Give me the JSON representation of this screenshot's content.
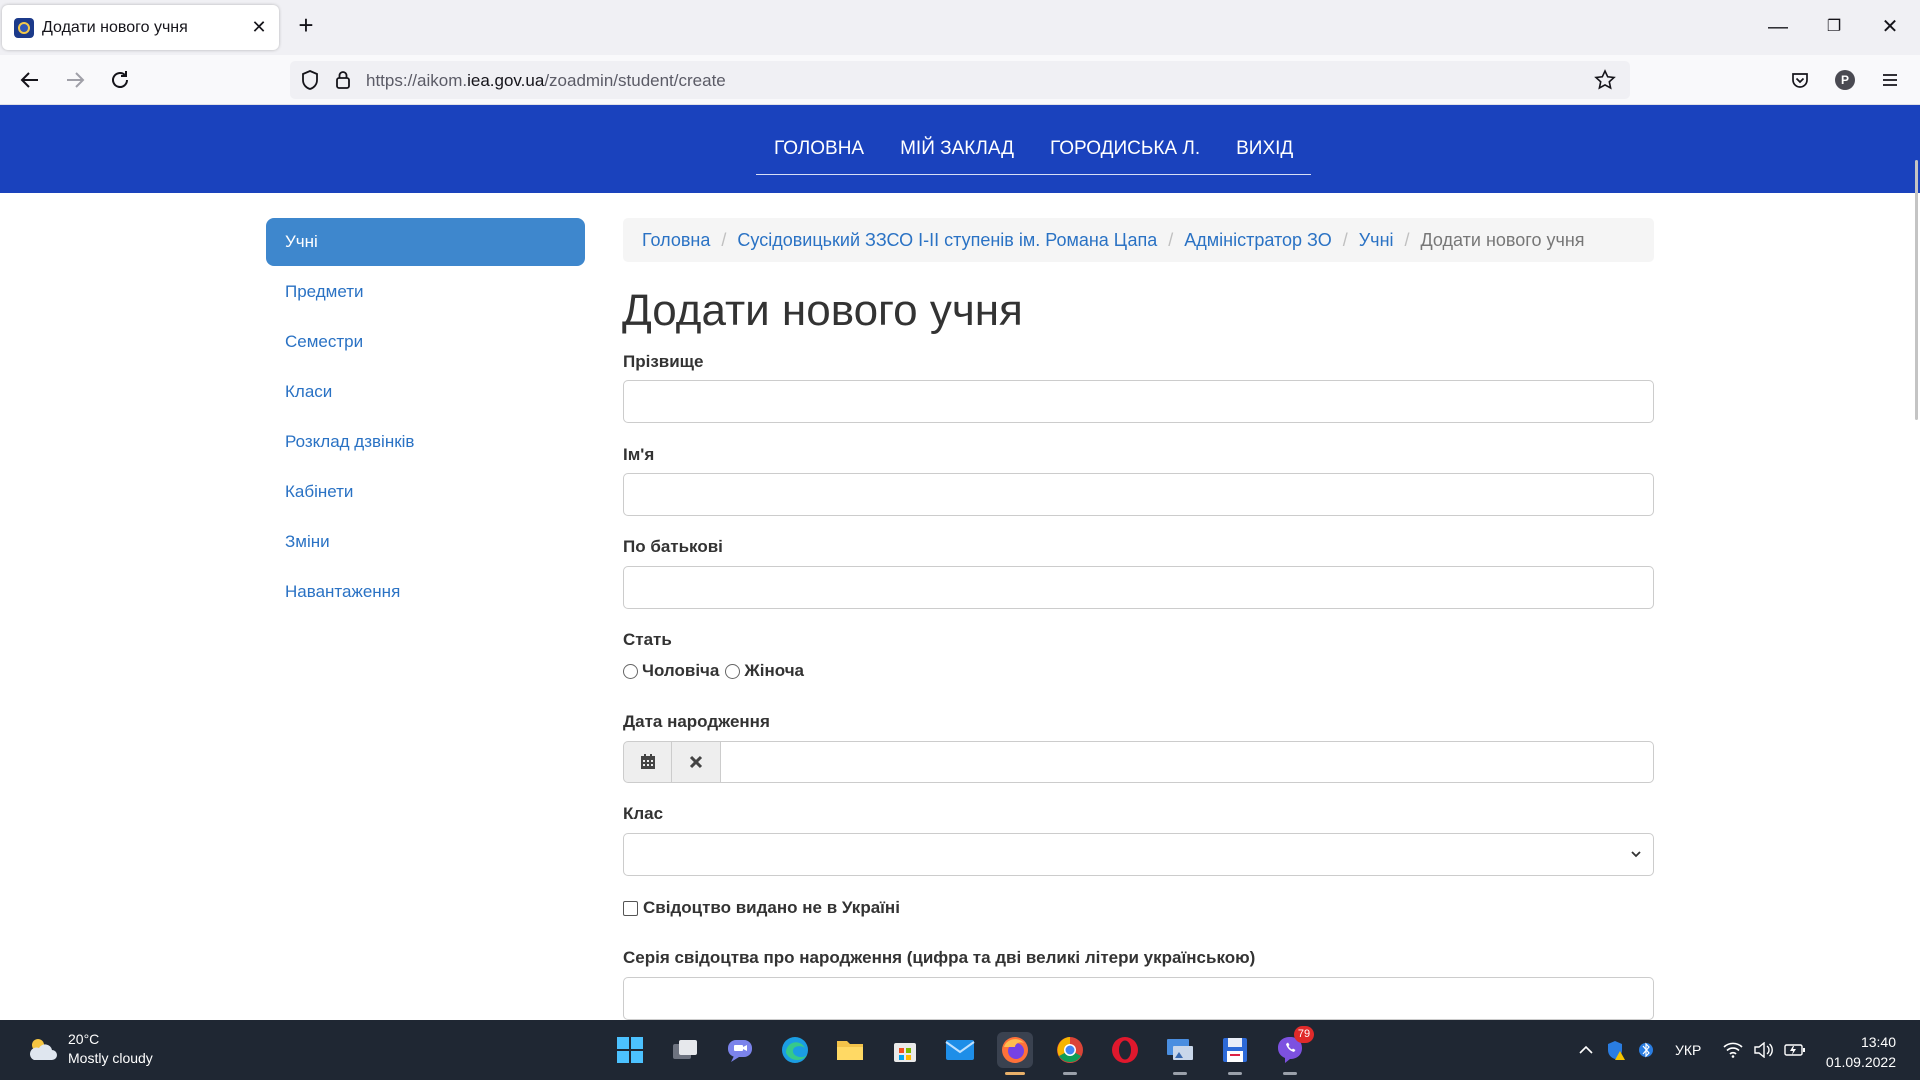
{
  "browser": {
    "tab_title": "Додати нового учня",
    "tab_close": "✕",
    "new_tab": "+",
    "url_prefix": "https://aikom.",
    "url_host": "iea.gov.ua",
    "url_path": "/zoadmin/student/create",
    "profile_initial": "P",
    "win_minimize": "—",
    "win_restore": "❐",
    "win_close": "✕"
  },
  "site_nav": [
    "ГОЛОВНА",
    "МІЙ ЗАКЛАД",
    "ГОРОДИСЬКА Л.",
    "ВИХІД"
  ],
  "sidebar": {
    "items": [
      {
        "label": "Учні",
        "active": true
      },
      {
        "label": "Предмети",
        "active": false
      },
      {
        "label": "Семестри",
        "active": false
      },
      {
        "label": "Класи",
        "active": false
      },
      {
        "label": "Розклад дзвінків",
        "active": false
      },
      {
        "label": "Кабінети",
        "active": false
      },
      {
        "label": "Зміни",
        "active": false
      },
      {
        "label": "Навантаження",
        "active": false
      }
    ]
  },
  "breadcrumb": {
    "links": [
      "Головна",
      "Сусідовицький ЗЗСО І-ІІ ступенів ім. Романа Цапа",
      "Адміністратор ЗО",
      "Учні"
    ],
    "separator": "/",
    "current": "Додати нового учня"
  },
  "page": {
    "title": "Додати нового учня"
  },
  "form": {
    "surname_label": "Прізвище",
    "surname_value": "",
    "name_label": "Ім'я",
    "name_value": "",
    "patronymic_label": "По батькові",
    "patronymic_value": "",
    "gender_label": "Стать",
    "gender_male": "Чоловіча",
    "gender_female": "Жіноча",
    "birthdate_label": "Дата народження",
    "birthdate_value": "",
    "class_label": "Клас",
    "class_value": "",
    "cert_abroad_label": "Свідоцтво видано не в Україні",
    "cert_series_label": "Серія свідоцтва про народження (цифра та дві великі літери українською)",
    "cert_series_value": ""
  },
  "taskbar": {
    "weather_temp": "20°C",
    "weather_desc": "Mostly cloudy",
    "viber_badge": "79",
    "language": "УКР",
    "time": "13:40",
    "date": "01.09.2022"
  },
  "colors": {
    "site_header": "#1a42bd",
    "sidebar_active": "#3e87cd",
    "link": "#2a72c4",
    "taskbar": "#1f2733"
  }
}
